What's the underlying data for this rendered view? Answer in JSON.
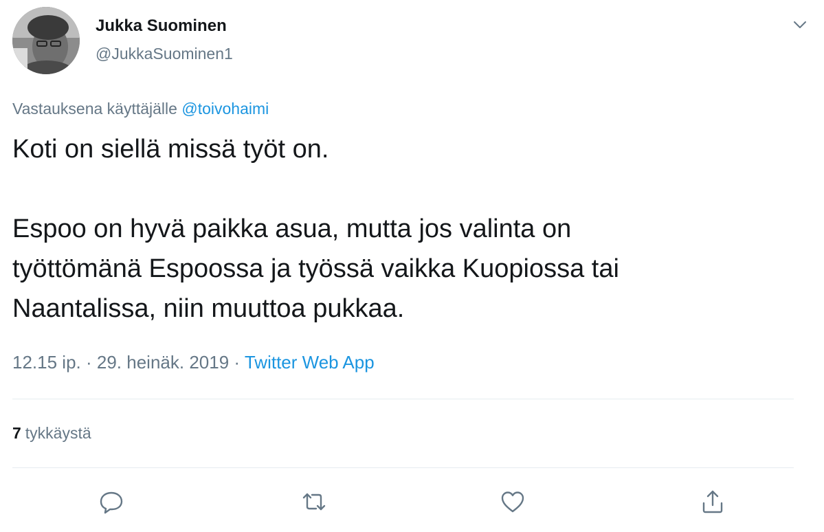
{
  "author": {
    "display_name": "Jukka Suominen",
    "handle": "@JukkaSuominen1",
    "avatar_icon": "profile-photo"
  },
  "reply_context": {
    "prefix": "Vastauksena käyttäjälle",
    "mention": "@toivohaimi"
  },
  "tweet": {
    "lines_para1": [
      "Koti on siellä missä työt on."
    ],
    "lines_para2": [
      "Espoo on hyvä paikka asua, mutta jos valinta on",
      "työttömänä Espoossa ja työssä vaikka Kuopiossa tai",
      "Naantalissa, niin muuttoa pukkaa."
    ]
  },
  "meta": {
    "time": "12.15 ip.",
    "separator": "·",
    "date": "29. heinäk. 2019",
    "source": "Twitter Web App"
  },
  "stats": {
    "likes_count": "7",
    "likes_label": "tykkäystä"
  },
  "actions": {
    "reply_icon": "reply-icon",
    "retweet_icon": "retweet-icon",
    "like_icon": "heart-icon",
    "share_icon": "share-icon",
    "menu_icon": "chevron-down-icon"
  },
  "colors": {
    "text": "#14171a",
    "secondary": "#657786",
    "link": "#1b95e0",
    "divider": "#e6ecf0"
  }
}
